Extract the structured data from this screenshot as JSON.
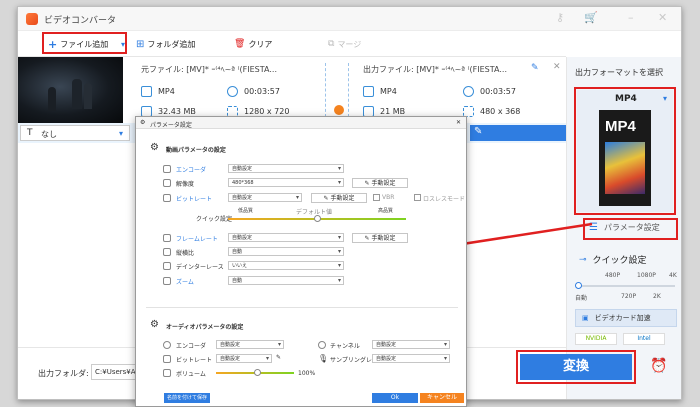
{
  "app": {
    "title": "ビデオコンバータ"
  },
  "toolbar": {
    "add_file": "ファイル追加",
    "add_folder": "フォルダ追加",
    "clear": "クリア",
    "merge": "マージ"
  },
  "file": {
    "source_label": "元ファイル: [MV]* ｰ⁽⁴ﾍ~ª ⁽(FIESTA...",
    "source_format": "MP4",
    "source_duration": "00:03:57",
    "source_size": "32.43 MB",
    "source_resolution": "1280 x 720",
    "output_label": "出力ファイル: [MV]* ｰ⁽⁴ﾍ~ª ⁽(FIESTA...",
    "output_format": "MP4",
    "output_duration": "00:03:57",
    "output_size": "21 MB",
    "output_resolution": "480 x 368",
    "subtitle": "なし"
  },
  "bottom": {
    "folder_label": "出力フォルダ:",
    "folder_path": "C:¥Users¥Admi"
  },
  "right": {
    "title": "出力フォーマットを選択",
    "format": "MP4",
    "param_settings": "パラメータ設定",
    "quick_settings": "クイック設定",
    "quality_top": [
      "480P",
      "1080P",
      "4K"
    ],
    "quality_bottom": [
      "自動",
      "720P",
      "2K"
    ],
    "gpu_accel": "ビデオカード加速",
    "nvidia": "NVIDIA",
    "intel": "Intel",
    "convert": "変換"
  },
  "dialog": {
    "title": "パラメータ設定",
    "video_section": "動画パラメータの設定",
    "audio_section": "オーディオパラメータの設定",
    "encoder_label": "エンコーダ",
    "encoder_value": "自動設定",
    "resolution_label": "解像度",
    "resolution_value": "480*368",
    "bitrate_label": "ビットレート",
    "bitrate_value": "自動設定",
    "manual": "手動設定",
    "vbr": "VBR",
    "lossless": "ロスレスモード",
    "quick_label": "クイック設定",
    "low_quality": "低品質",
    "default_value": "デフォルト値",
    "high_quality": "高品質",
    "framerate_label": "フレームレート",
    "framerate_value": "自動設定",
    "aspect_label": "縦横比",
    "aspect_value": "自動",
    "deinterlace_label": "デインターレース",
    "deinterlace_value": "いいえ",
    "zoom_label": "ズーム",
    "zoom_value": "自動",
    "a_encoder_label": "エンコーダ",
    "a_encoder_value": "自動設定",
    "a_bitrate_label": "ビットレート",
    "a_bitrate_value": "自動設定",
    "channel_label": "チャンネル",
    "channel_value": "自動設定",
    "sampling_label": "サンプリングレート",
    "sampling_value": "自動設定",
    "volume_label": "ボリューム",
    "volume_value": "100%",
    "save_as": "名前を付けて保存",
    "ok": "Ok",
    "cancel": "キャンセル"
  },
  "colors": {
    "accent": "#2f7de1",
    "highlight_box": "#e02020",
    "orange": "#f5831f"
  }
}
